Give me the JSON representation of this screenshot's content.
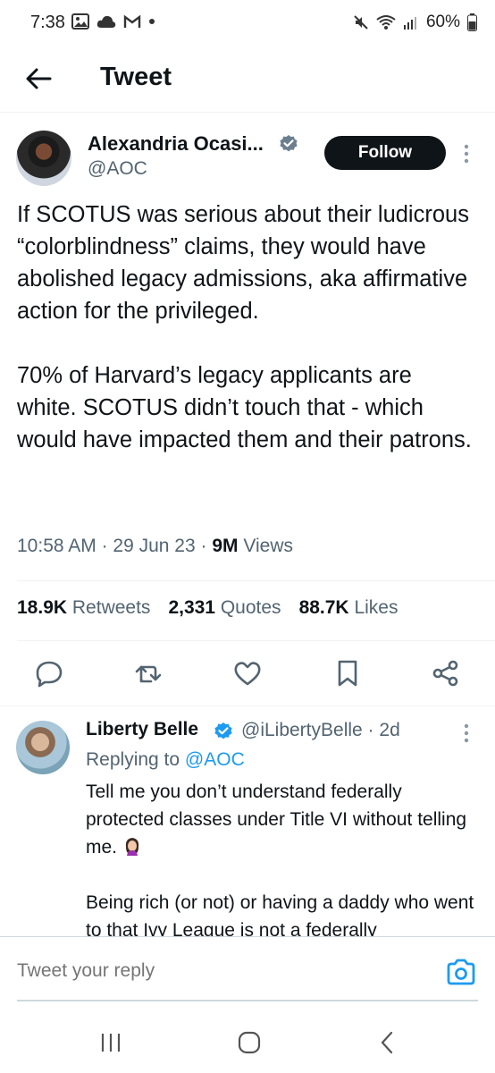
{
  "status_bar": {
    "time": "7:38",
    "battery": "60%",
    "left_icons": [
      "gallery-icon",
      "cloud-icon",
      "gmail-icon",
      "dot-icon"
    ],
    "right_icons": [
      "mute-icon",
      "wifi-icon",
      "signal-icon",
      "battery-icon"
    ]
  },
  "header": {
    "title": "Tweet"
  },
  "tweet": {
    "author_name": "Alexandria Ocasi...",
    "author_handle": "@AOC",
    "follow_label": "Follow",
    "text": "If SCOTUS was serious about their ludicrous “colorblindness” claims, they would have abolished legacy admissions, aka affirmative action for the privileged.\n\n70% of Harvard’s legacy applicants are white. SCOTUS didn’t touch that - which would have impacted them and their patrons.",
    "time": "10:58 AM",
    "date": "29 Jun 23",
    "views_count": "9M",
    "views_label": "Views",
    "retweets_count": "18.9K",
    "retweets_label": "Retweets",
    "quotes_count": "2,331",
    "quotes_label": "Quotes",
    "likes_count": "88.7K",
    "likes_label": "Likes"
  },
  "reply": {
    "author_name": "Liberty Belle",
    "author_handle": "@iLibertyBelle",
    "age": "2d",
    "replying_prefix": "Replying to",
    "replying_handle": "@AOC",
    "text": "Tell me you don’t understand federally protected classes under Title VI without telling me.",
    "text_after": "\n\nBeing rich (or not) or having a daddy who went to that Ivy League is not a federally"
  },
  "composer": {
    "placeholder": "Tweet your reply"
  },
  "colors": {
    "accent": "#1d9bf0",
    "text": "#0f1419",
    "muted": "#536471",
    "button": "#0f1419"
  }
}
